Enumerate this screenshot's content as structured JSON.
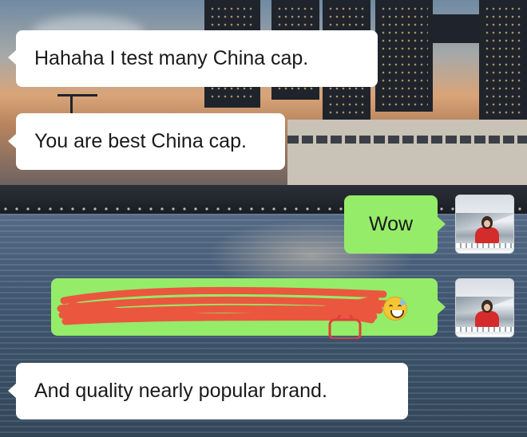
{
  "chat": {
    "messages": [
      {
        "sender": "other",
        "text": "Hahaha I test many China cap."
      },
      {
        "sender": "other",
        "text": "You are best China cap."
      },
      {
        "sender": "me",
        "text": "Wow"
      },
      {
        "sender": "me",
        "text": "",
        "redacted": true,
        "emoji": "grinning-sweat-emoji"
      },
      {
        "sender": "other",
        "text": "And quality nearly popular brand."
      }
    ]
  },
  "colors": {
    "incoming_bubble": "#ffffff",
    "outgoing_bubble": "#95ec69",
    "redaction_scribble": "#f0503c"
  }
}
